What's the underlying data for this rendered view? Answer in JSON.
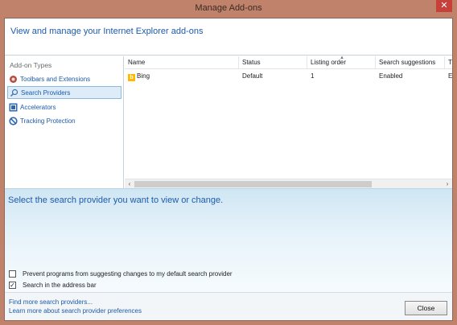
{
  "window": {
    "title": "Manage Add-ons",
    "close_glyph": "✕"
  },
  "header": {
    "text": "View and manage your Internet Explorer add-ons"
  },
  "sidebar": {
    "heading": "Add-on Types",
    "items": [
      {
        "label": "Toolbars and Extensions",
        "icon": "gear-icon"
      },
      {
        "label": "Search Providers",
        "icon": "search-icon",
        "selected": true
      },
      {
        "label": "Accelerators",
        "icon": "accelerator-icon"
      },
      {
        "label": "Tracking Protection",
        "icon": "no-symbol-icon"
      }
    ]
  },
  "list": {
    "columns": [
      "Name",
      "Status",
      "Listing order",
      "Search suggestions",
      "T"
    ],
    "rows": [
      {
        "name": "Bing",
        "status": "Default",
        "listing_order": "1",
        "search_suggestions": "Enabled",
        "extra": "E"
      }
    ]
  },
  "details": {
    "text": "Select the search provider you want to view or change.",
    "options": [
      {
        "label": "Prevent programs from suggesting changes to my default search provider",
        "checked": false
      },
      {
        "label": "Search in the address bar",
        "checked": true
      }
    ]
  },
  "footer": {
    "links": [
      "Find more search providers...",
      "Learn more about search provider preferences"
    ],
    "close_label": "Close"
  },
  "colors": {
    "accent": "#1e5ba8",
    "frame": "#c0826b",
    "selection": "#dcecf9"
  }
}
